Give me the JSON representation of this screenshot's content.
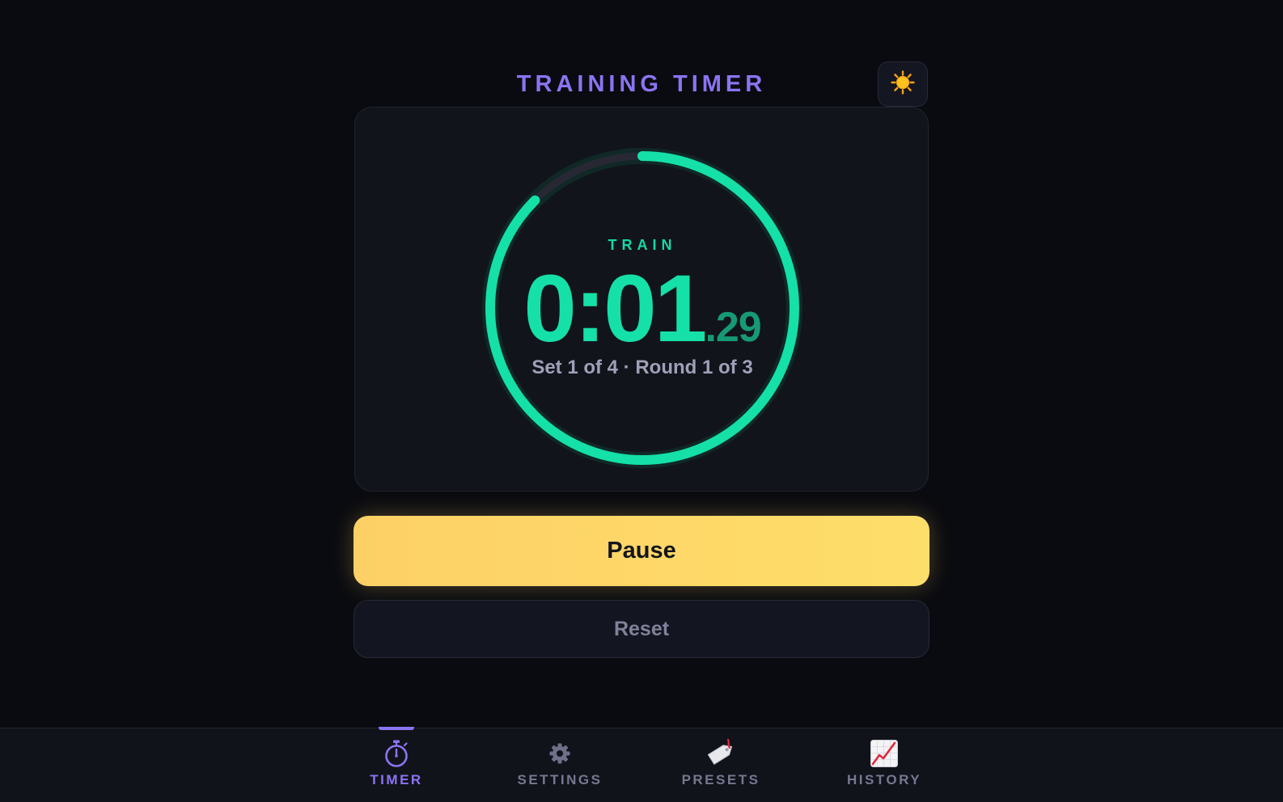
{
  "header": {
    "title": "TRAINING TIMER",
    "theme_icon": "sun-icon"
  },
  "timer": {
    "phase": "TRAIN",
    "time_main": "0:01",
    "time_fraction": ".29",
    "set_round": "Set 1 of 4 · Round 1 of 3",
    "progress_fraction": 0.875,
    "ring_color": "#14e0a8",
    "track_color": "#272833"
  },
  "controls": {
    "pause_label": "Pause",
    "reset_label": "Reset",
    "pause_color": "#fdd066"
  },
  "nav": {
    "items": [
      {
        "label": "TIMER",
        "icon": "stopwatch-icon",
        "active": true
      },
      {
        "label": "SETTINGS",
        "icon": "gear-icon",
        "active": false
      },
      {
        "label": "PRESETS",
        "icon": "bookmark-tag-icon",
        "active": false
      },
      {
        "label": "HISTORY",
        "icon": "chart-increasing-icon",
        "active": false
      }
    ],
    "accent_color": "#8b74f2"
  }
}
